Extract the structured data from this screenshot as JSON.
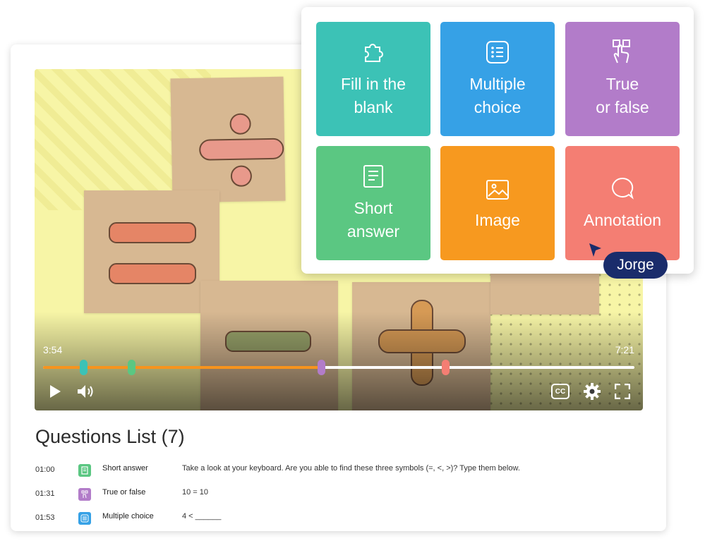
{
  "player": {
    "current_time": "3:54",
    "duration": "7:21",
    "progress": 0.475,
    "markers": [
      {
        "position": 0.069,
        "color": "#3cc2b6"
      },
      {
        "position": 0.15,
        "color": "#5bc782"
      },
      {
        "position": 0.471,
        "color": "#b27cc9"
      },
      {
        "position": 0.681,
        "color": "#f47e73"
      }
    ],
    "cc_label": "CC"
  },
  "question_types": [
    {
      "label": "Fill in the\nblank",
      "icon": "puzzle-icon",
      "color": "#3cc2b6"
    },
    {
      "label": "Multiple\nchoice",
      "icon": "list-icon",
      "color": "#36a1e6"
    },
    {
      "label": "True\nor false",
      "icon": "touch-icon",
      "color": "#b27cc9"
    },
    {
      "label": "Short\nanswer",
      "icon": "document-icon",
      "color": "#5bc782"
    },
    {
      "label": "Image",
      "icon": "image-icon",
      "color": "#f7991f"
    },
    {
      "label": "Annotation",
      "icon": "chat-bubble-icon",
      "color": "#f47e73"
    }
  ],
  "collaborator": {
    "name": "Jorge",
    "color": "#1a2c6b"
  },
  "questions_list": {
    "title": "Questions List (7)",
    "items": [
      {
        "time": "01:00",
        "type": "Short answer",
        "icon": "document-icon",
        "color": "#5bc782",
        "text": "Take a look at your keyboard. Are you able to find these three symbols (=, <, >)? Type them below."
      },
      {
        "time": "01:31",
        "type": "True or false",
        "icon": "touch-icon",
        "color": "#b27cc9",
        "text": "10 = 10"
      },
      {
        "time": "01:53",
        "type": "Multiple choice",
        "icon": "list-icon",
        "color": "#36a1e6",
        "text": "4 < ______"
      }
    ]
  }
}
